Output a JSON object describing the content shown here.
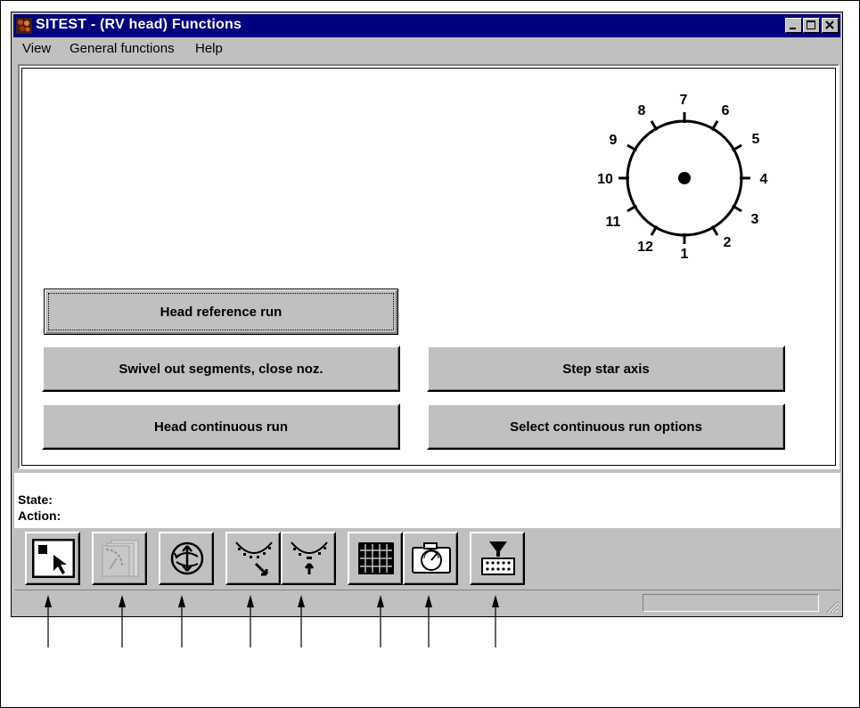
{
  "window": {
    "title": "SITEST  - (RV head) Functions",
    "controls": [
      "minimize",
      "maximize",
      "close"
    ]
  },
  "menu": {
    "items": [
      "View",
      "General functions",
      "Help"
    ]
  },
  "dial": {
    "labels": [
      "1",
      "2",
      "3",
      "4",
      "5",
      "6",
      "7",
      "8",
      "9",
      "10",
      "11",
      "12"
    ]
  },
  "buttons": {
    "head_reference_run": "Head reference run",
    "swivel_out": "Swivel out segments, close noz.",
    "step_star_axis": "Step star axis",
    "head_continuous_run": "Head continuous run",
    "select_continuous_run_options": "Select continuous run options"
  },
  "status": {
    "state_label": "State:",
    "action_label": "Action:"
  },
  "toolbar": {
    "icons": [
      "select-pointer-icon",
      "segments-icon",
      "rotate-icon",
      "swivel-out-icon",
      "swivel-in-icon",
      "grid-icon",
      "camera-gauge-icon",
      "nozzle-matrix-icon"
    ]
  }
}
